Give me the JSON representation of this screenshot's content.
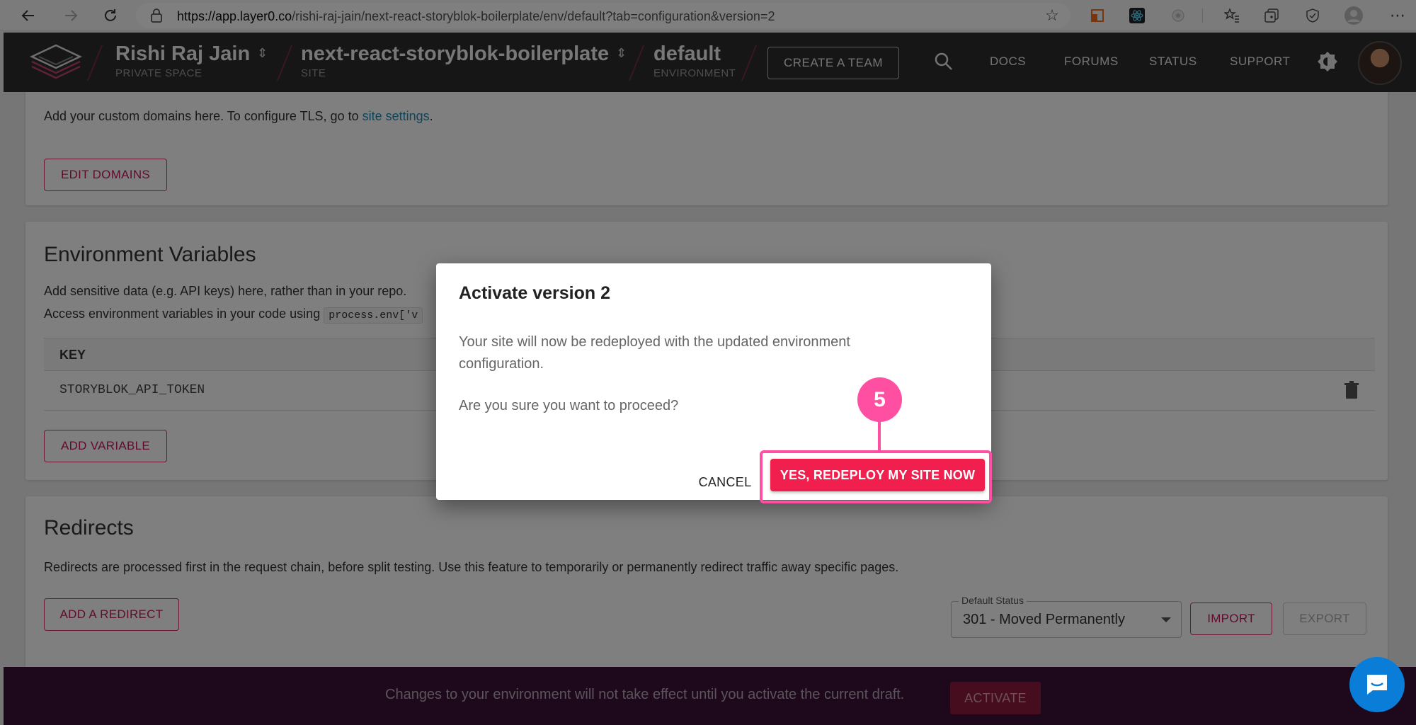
{
  "browser": {
    "url_host": "https://app.layer0.co",
    "url_path": "/rishi-raj-jain/next-react-storyblok-boilerplate/env/default?tab=configuration&version=2"
  },
  "header": {
    "team_name": "Rishi Raj Jain",
    "team_sub": "PRIVATE SPACE",
    "site_name": "next-react-storyblok-boilerplate",
    "site_sub": "SITE",
    "env_name": "default",
    "env_sub": "ENVIRONMENT",
    "create_team": "CREATE A TEAM",
    "links": [
      "DOCS",
      "FORUMS",
      "STATUS",
      "SUPPORT"
    ]
  },
  "domains": {
    "text_prefix": "Add your custom domains here. To configure TLS, go to ",
    "text_link": "site settings",
    "text_suffix": ".",
    "edit_button": "EDIT DOMAINS"
  },
  "env_vars": {
    "title": "Environment Variables",
    "line1": "Add sensitive data (e.g. API keys) here, rather than in your repo.",
    "line2": "Access environment variables in your code using",
    "code": "process.env['v",
    "col_key": "KEY",
    "row_key": "STORYBLOK_API_TOKEN",
    "add_button": "ADD VARIABLE"
  },
  "redirects": {
    "title": "Redirects",
    "text": "Redirects are processed first in the request chain, before split testing. Use this feature to temporarily or permanently redirect traffic away specific pages.",
    "add_button": "ADD A REDIRECT",
    "default_status_label": "Default Status",
    "default_status_value": "301 - Moved Permanently",
    "import_button": "IMPORT",
    "export_button": "EXPORT"
  },
  "dialog": {
    "title": "Activate version 2",
    "message": "Your site will now be redeployed with the updated environment configuration.",
    "question": "Are you sure you want to proceed?",
    "cancel": "CANCEL",
    "confirm": "YES, REDEPLOY MY SITE NOW"
  },
  "callout": {
    "step": "5",
    "color": "#ff4fa3"
  },
  "banner": {
    "text": "Changes to your environment will not take effect until you activate the current draft.",
    "activate": "ACTIVATE"
  },
  "colors": {
    "accent": "#f01f4e",
    "header_bg": "#2d2d2d",
    "banner_bg": "#3d1239",
    "link": "#1a8bb5"
  }
}
